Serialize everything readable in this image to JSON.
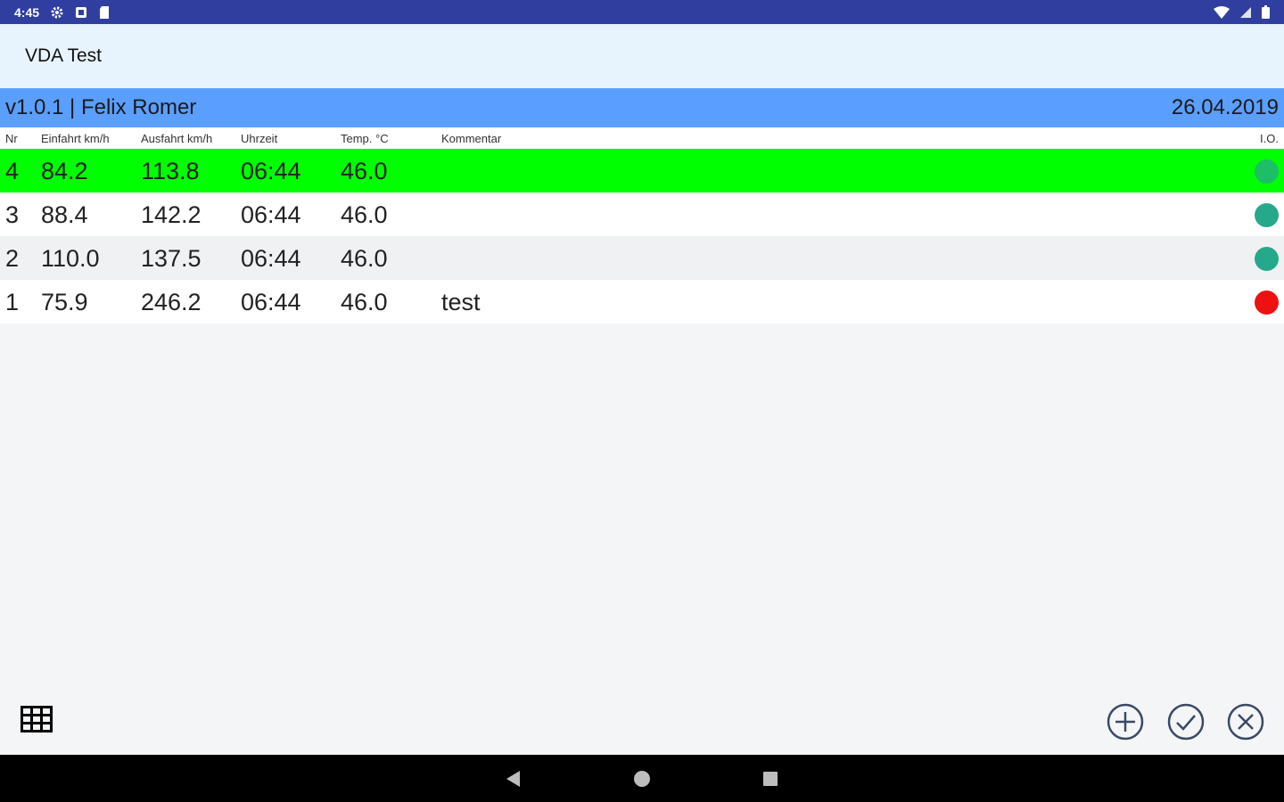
{
  "status_bar": {
    "time": "4:45",
    "left_icons": [
      "gear-icon",
      "notification-icon",
      "sd-card-icon"
    ],
    "right_icons": [
      "wifi-icon",
      "cell-signal-icon",
      "battery-icon"
    ]
  },
  "app": {
    "title": "VDA Test"
  },
  "info": {
    "version_user": "v1.0.1 | Felix Romer",
    "date": "26.04.2019"
  },
  "table": {
    "headers": [
      "Nr",
      "Einfahrt km/h",
      "Ausfahrt km/h",
      "Uhrzeit",
      "Temp. °C",
      "Kommentar",
      "I.O."
    ],
    "rows": [
      {
        "nr": "4",
        "einfahrt": "84.2",
        "ausfahrt": "113.8",
        "uhrzeit": "06:44",
        "temp": "46.0",
        "kommentar": "",
        "status": "ok",
        "selected": true
      },
      {
        "nr": "3",
        "einfahrt": "88.4",
        "ausfahrt": "142.2",
        "uhrzeit": "06:44",
        "temp": "46.0",
        "kommentar": "",
        "status": "ok",
        "selected": false
      },
      {
        "nr": "2",
        "einfahrt": "110.0",
        "ausfahrt": "137.5",
        "uhrzeit": "06:44",
        "temp": "46.0",
        "kommentar": "",
        "status": "ok",
        "selected": false
      },
      {
        "nr": "1",
        "einfahrt": "75.9",
        "ausfahrt": "246.2",
        "uhrzeit": "06:44",
        "temp": "46.0",
        "kommentar": "test",
        "status": "nok",
        "selected": false
      }
    ]
  },
  "toolbar": {
    "left": "table-grid-icon",
    "right": [
      "add-circle-icon",
      "check-circle-icon",
      "cancel-circle-icon"
    ]
  },
  "nav": [
    "back-icon",
    "home-icon",
    "recents-icon"
  ],
  "colors": {
    "status_bar": "#303f9f",
    "app_bar": "#e8f4fd",
    "info_bar": "#5a9eff",
    "selected_row": "#00ff00",
    "row_alt": "#f0f1f3",
    "row_plain": "#ffffff",
    "status_ok": "#26a98b",
    "status_nok": "#ee1111",
    "icon_blue": "#3a4a66"
  }
}
